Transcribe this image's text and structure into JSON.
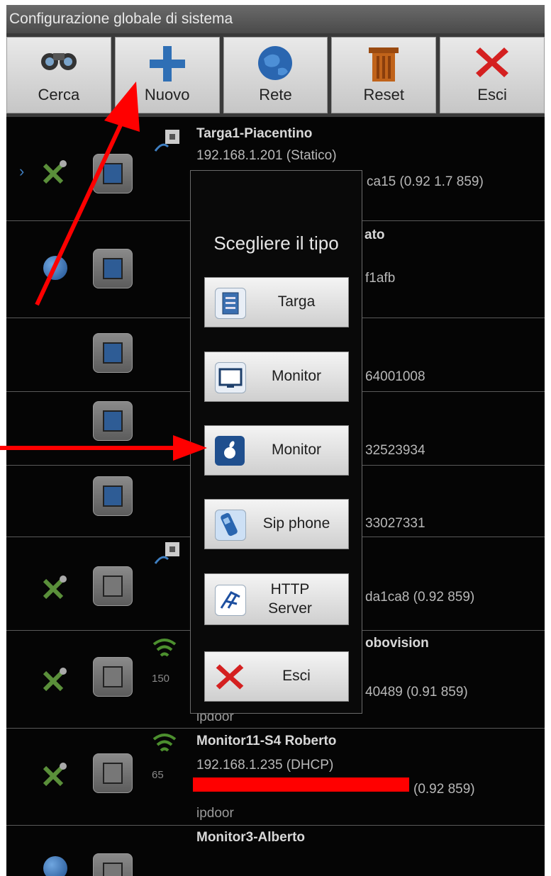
{
  "window": {
    "title": "Configurazione globale di sistema"
  },
  "toolbar": {
    "buttons": [
      {
        "label": "Cerca",
        "icon": "binoculars-icon"
      },
      {
        "label": "Nuovo",
        "icon": "plus-icon"
      },
      {
        "label": "Rete",
        "icon": "globe-icon"
      },
      {
        "label": "Reset",
        "icon": "trash-icon"
      },
      {
        "label": "Esci",
        "icon": "red-x-icon"
      }
    ]
  },
  "list": {
    "rows": [
      {
        "name": "Targa1-Piacentino",
        "ip": "192.168.1.201 (Statico)",
        "frag": "ca15  (0.92 1.7 859)"
      },
      {
        "name_frag": "ato",
        "frag": "f1afb"
      },
      {
        "frag": "64001008"
      },
      {
        "frag": "32523934"
      },
      {
        "frag": "33027331"
      },
      {
        "frag": "da1ca8  (0.92 859)"
      },
      {
        "name_frag": "obovision",
        "wifi": "150",
        "frag": "40489  (0.91 859)",
        "sub": "ipdoor"
      },
      {
        "name": "Monitor11-S4 Roberto",
        "ip": "192.168.1.235 (DHCP)",
        "wifi": "65",
        "frag": "(0.92 859)",
        "sub": "ipdoor"
      },
      {
        "name": "Monitor3-Alberto"
      }
    ]
  },
  "dialog": {
    "title": "Scegliere il tipo",
    "buttons": [
      {
        "label": "Targa",
        "icon": "panel-icon"
      },
      {
        "label": "Monitor",
        "icon": "monitor-icon"
      },
      {
        "label": "Monitor",
        "icon": "apple-icon"
      },
      {
        "label": "Sip phone",
        "icon": "phone-icon"
      },
      {
        "label": "HTTP Server",
        "icon": "http-server-icon"
      },
      {
        "label": "Esci",
        "icon": "red-x-icon"
      }
    ]
  },
  "colors": {
    "annotation_red": "#ff0000",
    "dark_bg": "#050505"
  }
}
